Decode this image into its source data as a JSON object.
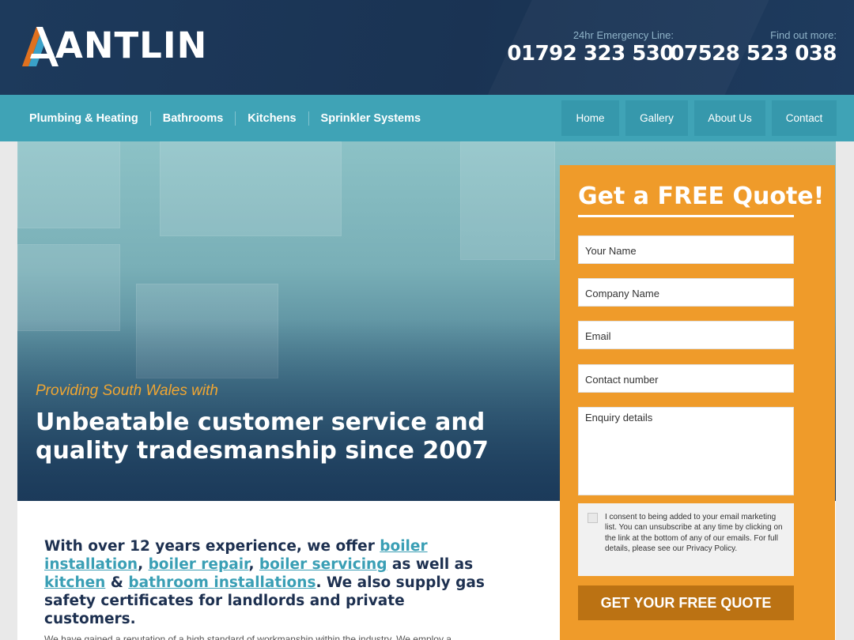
{
  "brand": {
    "name": "ANTLIN"
  },
  "header": {
    "emergency_label": "24hr Emergency Line:",
    "emergency_number": "01792 323 530",
    "info_label": "Find out more:",
    "info_number": "07528 523 038"
  },
  "nav": {
    "services": [
      "Plumbing & Heating",
      "Bathrooms",
      "Kitchens",
      "Sprinkler Systems"
    ],
    "pages": [
      "Home",
      "Gallery",
      "About Us",
      "Contact"
    ]
  },
  "hero": {
    "tagline": "Providing South Wales with",
    "title": "Unbeatable customer service and quality tradesmanship since 2007"
  },
  "intro": {
    "p1": "With over 12 years experience, we offer ",
    "link1": "boiler installation",
    "p2": ", ",
    "link2": "boiler repair",
    "p3": ", ",
    "link3": "boiler servicing",
    "p4": " as well as ",
    "link4": "kitchen",
    "p5": " & ",
    "link5": "bathroom installations",
    "p6": ". We also supply gas safety certificates for landlords and private customers.",
    "more": "We have gained a reputation of a high standard of workmanship within the industry. We employ a"
  },
  "quote": {
    "title": "Get a FREE Quote!",
    "name_placeholder": "Your Name",
    "company_placeholder": "Company Name",
    "email_placeholder": "Email",
    "phone_placeholder": "Contact number",
    "enquiry_placeholder": "Enquiry details",
    "consent": "I consent to being added to your email marketing list. You can unsubscribe at any time by clicking on the link at the bottom of any of our emails. For full details, please see our Privacy Policy.",
    "submit_label": "GET YOUR FREE QUOTE"
  },
  "colors": {
    "header_bg": "#1a3353",
    "nav_bg": "#3fa3b6",
    "accent_orange": "#ef9b2a",
    "submit_bg": "#bb7213",
    "link": "#3a9fb5"
  },
  "icons": [
    "antlin-logo-mark"
  ]
}
